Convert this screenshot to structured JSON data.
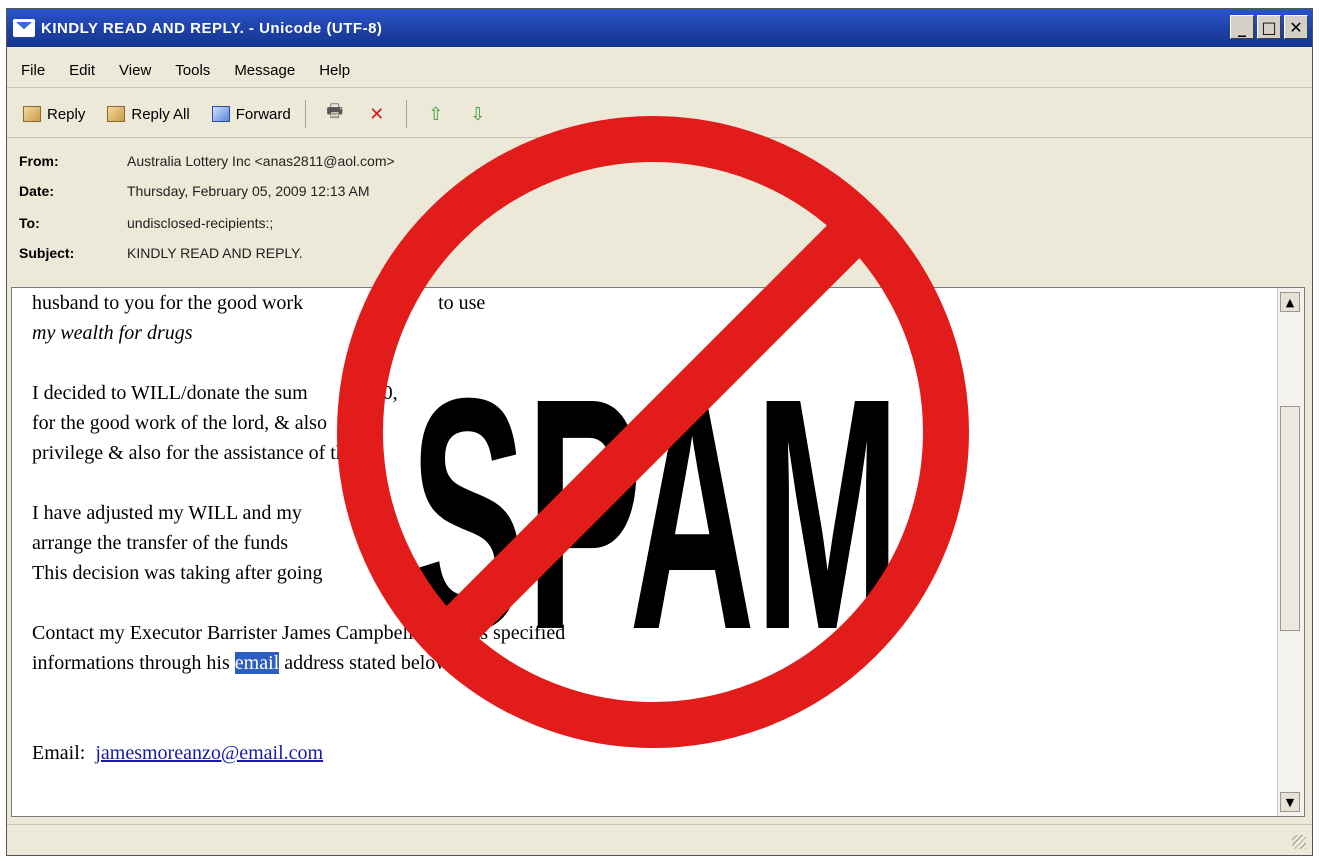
{
  "window": {
    "title": "KINDLY READ AND REPLY. - Unicode (UTF-8)",
    "controls": {
      "minimize": "_",
      "maximize": "□",
      "close": "✕"
    }
  },
  "menu": [
    "File",
    "Edit",
    "View",
    "Tools",
    "Message",
    "Help"
  ],
  "toolbar": {
    "reply": "Reply",
    "reply_all": "Reply All",
    "forward": "Forward",
    "print_icon": "🖶",
    "delete_icon": "✕",
    "prev_icon": "⇧",
    "next_icon": "⇩"
  },
  "headers": {
    "from_label": "From:",
    "from_value": "Australia Lottery Inc <anas2811@aol.com>",
    "date_label": "Date:",
    "date_value": "Thursday, February 05, 2009 12:13 AM",
    "to_label": "To:",
    "to_value": "undisclosed-recipients:;",
    "subject_label": "Subject:",
    "subject_value": "KINDLY READ AND REPLY."
  },
  "body": {
    "p1_line1": "husband to you for the good work",
    "p1_line1_end": "to use",
    "p1_line2": "my wealth for drugs",
    "p2_line1": "  I decided to WILL/donate the sum",
    "p2_line1_end": "500,",
    "p2_line2": "for the good work of the lord, & also",
    "p2_line3": "privilege & also for the assistance of the",
    "p3_line1": "  I have adjusted my WILL and my",
    "p3_line2": "arrange the transfer of the funds",
    "p3_line3": "This decision was taking after going",
    "p4_line1": "Contact my Executor Barrister James Campbell with this specified",
    "p4_line2_start": "informations through his",
    "p4_line2_highlight": "email",
    "p4_line2_end": "address stated below.",
    "email_label": "Email:",
    "email_value": "jamesmoreanzo@email.com"
  },
  "overlay": {
    "text": "SPAM",
    "ring_color": "#e21b1b",
    "text_color": "#000000"
  }
}
